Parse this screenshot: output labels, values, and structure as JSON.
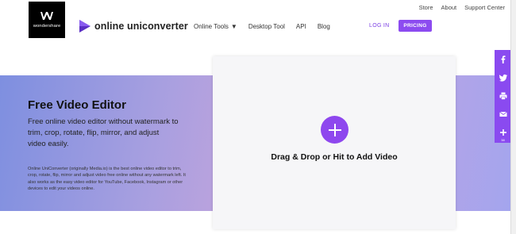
{
  "util_links": [
    "Store",
    "About",
    "Support Center"
  ],
  "logo": {
    "text": "wondershare"
  },
  "brand": {
    "name": "online uniconverter",
    "color": "#6d3bd8"
  },
  "nav": [
    {
      "label": "Online Tools",
      "has_dropdown": true
    },
    {
      "label": "Desktop Tool"
    },
    {
      "label": "API"
    },
    {
      "label": "Blog"
    }
  ],
  "auth": {
    "login": "LOG IN",
    "pricing": "PRICING"
  },
  "hero": {
    "title": "Free Video Editor",
    "subtitle": "Free online video editor without watermark to trim, crop, rotate, flip, mirror, and adjust video easily.",
    "description": "Online UniConverter (originally Media.io) is the best online video editor to trim, crop, rotate, flip, mirror and adjust video free online without any watermark left. It also works as the easy video editor for YouTube, Facebook, Instagram or other devices to edit your videos online."
  },
  "upload": {
    "label": "Drag & Drop or Hit to Add Video",
    "icon": "plus-icon"
  },
  "share": {
    "items": [
      "facebook-icon",
      "twitter-icon",
      "print-icon",
      "email-icon",
      "more-icon"
    ],
    "count": "38"
  },
  "colors": {
    "accent": "#8c4bf0",
    "link": "#7b3fe4"
  }
}
